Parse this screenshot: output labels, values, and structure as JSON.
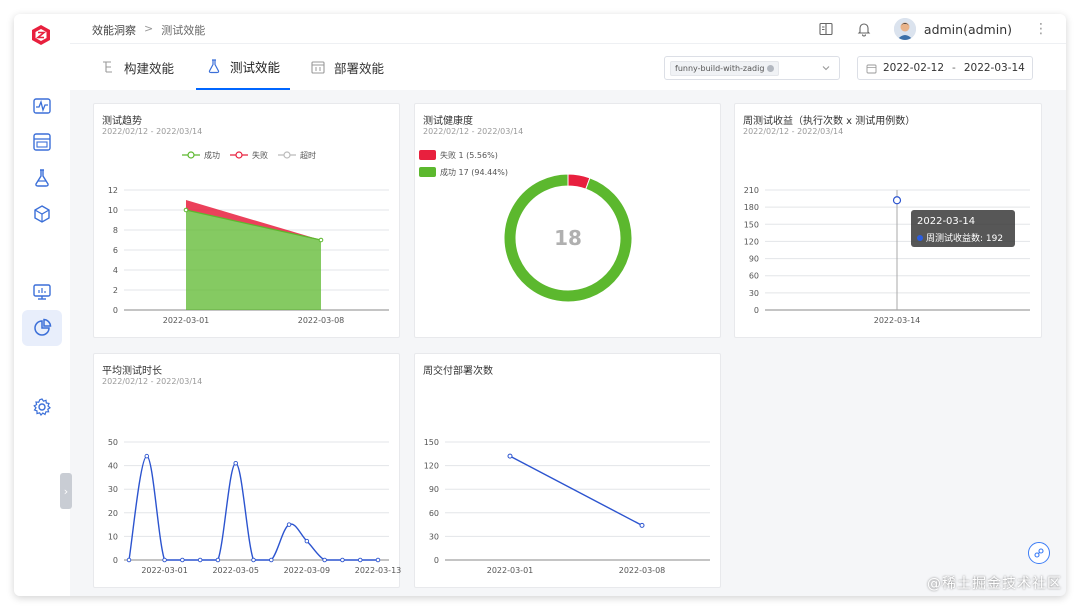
{
  "breadcrumb": {
    "root": "效能洞察",
    "sep": ">",
    "current": "测试效能"
  },
  "user": {
    "name": "admin(admin)"
  },
  "tabs": [
    {
      "label": "构建效能",
      "active": false
    },
    {
      "label": "测试效能",
      "active": true
    },
    {
      "label": "部署效能",
      "active": false
    }
  ],
  "filter": {
    "tag": "funny-build-with-zadig"
  },
  "daterange": {
    "start": "2022-02-12",
    "sep": "-",
    "end": "2022-03-14"
  },
  "colors": {
    "accent": "#0066ff",
    "success": "#5cb82e",
    "fail": "#e8203e",
    "line": "#2c54cf"
  },
  "cards": {
    "trend": {
      "title": "测试趋势",
      "sub": "2022/02/12 - 2022/03/14"
    },
    "health": {
      "title": "测试健康度",
      "sub": "2022/02/12 - 2022/03/14"
    },
    "weekly": {
      "title": "周测试收益（执行次数 x 测试用例数）",
      "sub": "2022/02/12 - 2022/03/14"
    },
    "duration": {
      "title": "平均测试时长",
      "sub": "2022/02/12 - 2022/03/14"
    },
    "deploy": {
      "title": "周交付部署次数"
    }
  },
  "watermark": "@稀土掘金技术社区",
  "chart_data": [
    {
      "type": "area",
      "title": "测试趋势",
      "x": [
        "2022-03-01",
        "2022-03-08"
      ],
      "legend": [
        "成功",
        "失败",
        "超时"
      ],
      "series": [
        {
          "name": "成功",
          "values": [
            10,
            7
          ]
        },
        {
          "name": "失败",
          "values": [
            1,
            0
          ]
        },
        {
          "name": "超时",
          "values": [
            0,
            0
          ]
        }
      ],
      "yticks": [
        0,
        2,
        4,
        6,
        8,
        10,
        12
      ],
      "ylim": [
        0,
        12
      ],
      "grid": true,
      "legend_position": "top-center"
    },
    {
      "type": "pie",
      "title": "测试健康度",
      "center_label": "18",
      "slices": [
        {
          "name": "失败",
          "count": 1,
          "label": "失败 1 (5.56%)"
        },
        {
          "name": "成功",
          "count": 17,
          "label": "成功 17 (94.44%)"
        }
      ],
      "legend_position": "top-left"
    },
    {
      "type": "scatter",
      "title": "周测试收益（执行次数 x 测试用例数）",
      "x": [
        "2022-03-14"
      ],
      "series": [
        {
          "name": "周测试收益数",
          "values": [
            192
          ]
        }
      ],
      "yticks": [
        0,
        30,
        60,
        90,
        120,
        150,
        180,
        210
      ],
      "ylim": [
        0,
        210
      ],
      "tooltip": {
        "title": "2022-03-14",
        "label": "周测试收益数: 192"
      },
      "grid": true
    },
    {
      "type": "line",
      "title": "平均测试时长",
      "x": [
        "2022-02-27",
        "2022-02-28",
        "2022-03-01",
        "2022-03-02",
        "2022-03-03",
        "2022-03-04",
        "2022-03-05",
        "2022-03-06",
        "2022-03-07",
        "2022-03-08",
        "2022-03-09",
        "2022-03-10",
        "2022-03-11",
        "2022-03-12",
        "2022-03-13"
      ],
      "xticks": [
        "2022-03-01",
        "2022-03-05",
        "2022-03-09",
        "2022-03-13"
      ],
      "series": [
        {
          "values": [
            0,
            44,
            0,
            0,
            0,
            0,
            41,
            0,
            0,
            15,
            8,
            0,
            0,
            0,
            0
          ]
        }
      ],
      "yticks": [
        0,
        10,
        20,
        30,
        40,
        50
      ],
      "ylim": [
        0,
        50
      ],
      "smooth": true,
      "grid": true
    },
    {
      "type": "line",
      "title": "周交付部署次数",
      "x": [
        "2022-03-01",
        "2022-03-08"
      ],
      "series": [
        {
          "values": [
            132,
            44
          ]
        }
      ],
      "yticks": [
        0,
        30,
        60,
        90,
        120,
        150
      ],
      "ylim": [
        0,
        150
      ],
      "grid": true
    }
  ]
}
